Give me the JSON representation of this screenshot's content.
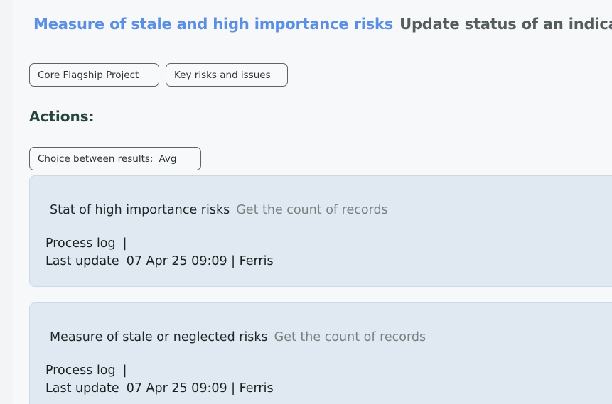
{
  "header": {
    "title_link": "Measure of stale and high importance risks",
    "title_sub": "Update status of an indicator"
  },
  "tags": [
    {
      "label": "Core Flagship Project"
    },
    {
      "label": "Key risks and issues"
    }
  ],
  "actions": {
    "heading": "Actions:",
    "choice": {
      "label": "Choice between results:",
      "value": "Avg"
    }
  },
  "cards": [
    {
      "title": "Stat of high importance risks",
      "description": "Get the count of records",
      "process_log_label": "Process log",
      "process_log_sep": "|",
      "last_update_label": "Last update",
      "last_update_value": "07 Apr 25 09:09 | Ferris"
    },
    {
      "title": "Measure of stale or neglected risks",
      "description": "Get the count of records",
      "process_log_label": "Process log",
      "process_log_sep": "|",
      "last_update_label": "Last update",
      "last_update_value": "07 Apr 25 09:09 | Ferris"
    }
  ],
  "colors": {
    "title_link": "#5b8fe3",
    "title_sub": "#555c5e",
    "actions_heading": "#25453a",
    "card_bg": "#e0e9f2",
    "page_bg": "#f6f8f9"
  }
}
